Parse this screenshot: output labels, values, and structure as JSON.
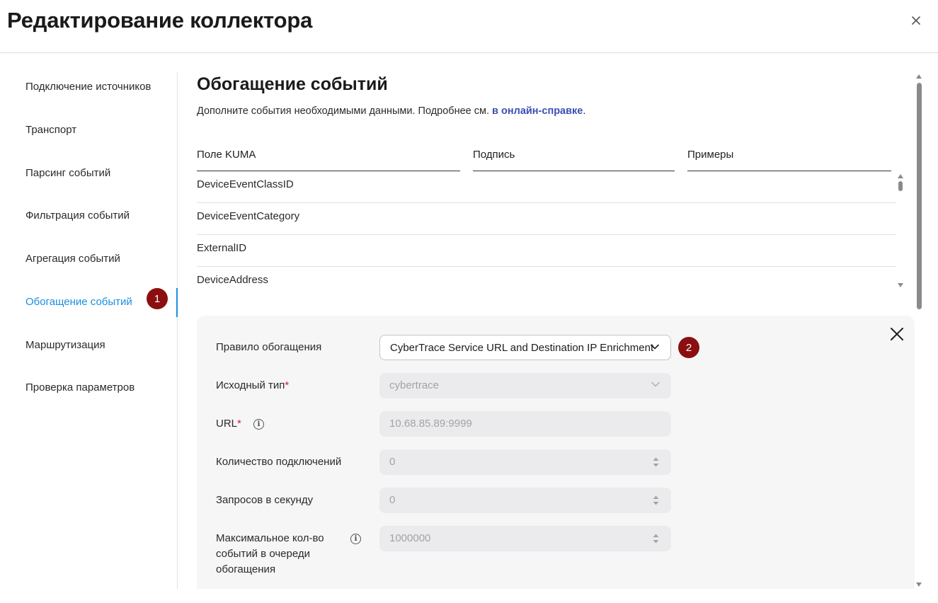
{
  "header": {
    "title": "Редактирование коллектора",
    "close_icon": "close-icon"
  },
  "sidebar": {
    "items": [
      {
        "label": "Подключение источников"
      },
      {
        "label": "Транспорт"
      },
      {
        "label": "Парсинг событий"
      },
      {
        "label": "Фильтрация событий"
      },
      {
        "label": "Агрегация событий"
      },
      {
        "label": "Обогащение событий",
        "active": true
      },
      {
        "label": "Маршрутизация"
      },
      {
        "label": "Проверка параметров"
      }
    ],
    "active_color": "#1c8fe0"
  },
  "badges": {
    "one": "1",
    "two": "2",
    "color": "#8b0f10"
  },
  "main": {
    "title": "Обогащение событий",
    "description_prefix": "Дополните события необходимыми данными. Подробнее см. ",
    "description_link": "в онлайн-справке",
    "description_suffix": "."
  },
  "table": {
    "headers": [
      "Поле KUMA",
      "Подпись",
      "Примеры"
    ],
    "rows": [
      "DeviceEventClassID",
      "DeviceEventCategory",
      "ExternalID",
      "DeviceAddress"
    ]
  },
  "form": {
    "rule": {
      "label": "Правило обогащения",
      "value": "CyberTrace Service URL and Destination IP Enrichment"
    },
    "source_type": {
      "label": "Исходный тип",
      "required": "*",
      "value": "cybertrace"
    },
    "url": {
      "label": "URL",
      "required": "*",
      "value": "10.68.85.89:9999",
      "info": "i"
    },
    "connections": {
      "label": "Количество подключений",
      "value": "0"
    },
    "rps": {
      "label": "Запросов в секунду",
      "value": "0"
    },
    "queue": {
      "label_line1": "Максимальное кол-во",
      "label_line2": "событий в очереди",
      "label_line3": "обогащения",
      "value": "1000000",
      "info": "i"
    }
  }
}
